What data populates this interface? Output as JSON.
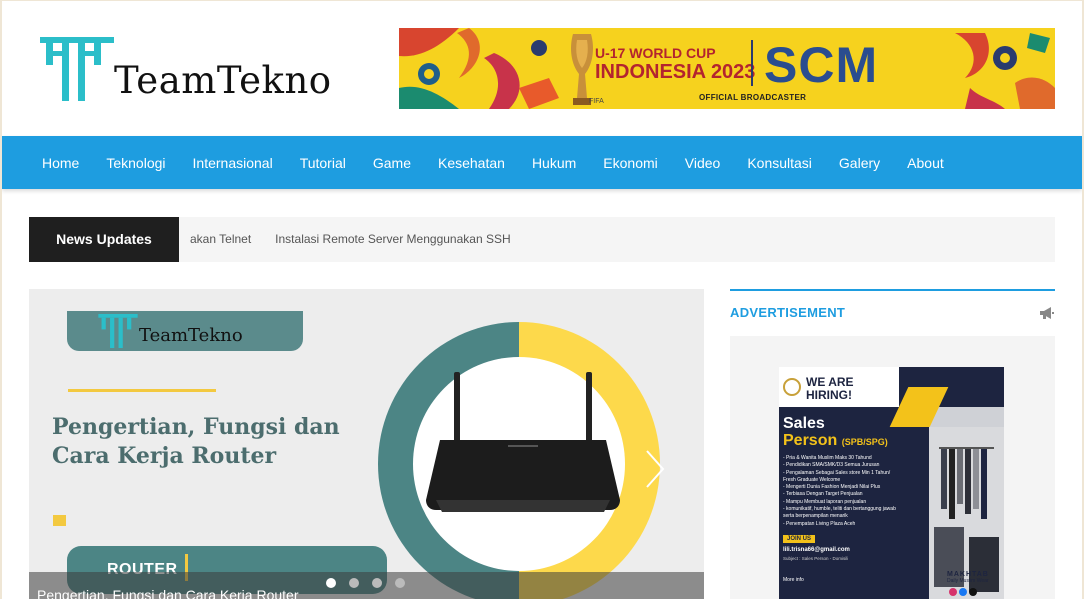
{
  "site": {
    "logo_text": "TeamTekno"
  },
  "banner": {
    "title_line1": "U-17 WORLD CUP",
    "title_line2": "INDONESIA 2023",
    "brand": "SCM",
    "broadcaster": "OFFICIAL BROADCASTER",
    "fifa": "FIFA"
  },
  "nav": {
    "items": [
      "Home",
      "Teknologi",
      "Internasional",
      "Tutorial",
      "Game",
      "Kesehatan",
      "Hukum",
      "Ekonomi",
      "Video",
      "Konsultasi",
      "Galery",
      "About"
    ]
  },
  "ticker": {
    "label": "News Updates",
    "items": [
      "akan Telnet",
      "Instalasi Remote Server Menggunakan SSH"
    ]
  },
  "slider": {
    "logo_text": "TeamTekno",
    "title": "Pengertian, Fungsi dan Cara Kerja Router",
    "tag": "ROUTER",
    "caption": "Pengertian, Fungsi dan Cara Kerja Router",
    "dots": 4,
    "active_dot": 1,
    "colors": {
      "teal": "#4c8585",
      "yellow": "#fdd94b"
    }
  },
  "sidebar": {
    "heading": "ADVERTISEMENT",
    "poster": {
      "hiring": "WE ARE HIRING!",
      "sales": "Sales",
      "person": "Person",
      "person_tag": "(SPB/SPG)",
      "requirements": [
        "- Pria & Wanita Muslim Maks 30 Tahund",
        "- Pendidikan SMA/SMK/D3 Semua Jurusan",
        "- Pengalaman Sebagai Sales store Min 1 Tahun/",
        "  Fresh Graduate Welcome",
        "- Mengerti Dunia Fashion Menjadi Nilai Plus",
        "- Terbiasa Dengan Target Penjualan",
        "- Mampu Membuat laporan penjualan",
        "- komunikatif, humble, teliti dan bertanggung jawab",
        "  serta berpenampilan menarik",
        "- Penempatan Living Plaza Aceh"
      ],
      "join": "JOIN US",
      "email": "lili.trisna66@gmail.com",
      "subject": "Subject : Sales Person - Domisili",
      "more_info": "More info",
      "brand": "MAKHTAB",
      "brand_sub": "Daily Muslim Wear"
    }
  }
}
